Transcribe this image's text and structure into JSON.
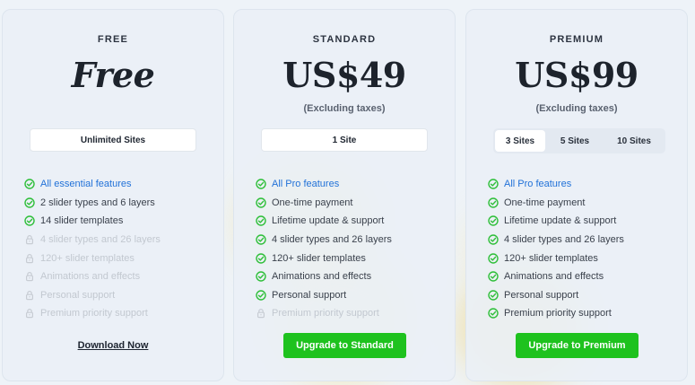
{
  "plans": {
    "free": {
      "tier": "FREE",
      "price": "Free",
      "sites_label": "Unlimited Sites",
      "features": [
        {
          "text": "All essential features",
          "state": "link"
        },
        {
          "text": "2 slider types and 6 layers",
          "state": "included"
        },
        {
          "text": "14 slider templates",
          "state": "included"
        },
        {
          "text": "4 slider types and 26 layers",
          "state": "locked"
        },
        {
          "text": "120+ slider templates",
          "state": "locked"
        },
        {
          "text": "Animations and effects",
          "state": "locked"
        },
        {
          "text": "Personal support",
          "state": "locked"
        },
        {
          "text": "Premium priority support",
          "state": "locked"
        }
      ],
      "action_label": "Download Now"
    },
    "standard": {
      "tier": "STANDARD",
      "price": "US$49",
      "taxes": "(Excluding taxes)",
      "sites_label": "1 Site",
      "features": [
        {
          "text": "All Pro features",
          "state": "link"
        },
        {
          "text": "One-time payment",
          "state": "included"
        },
        {
          "text": "Lifetime update & support",
          "state": "included"
        },
        {
          "text": "4 slider types and 26 layers",
          "state": "included"
        },
        {
          "text": "120+ slider templates",
          "state": "included"
        },
        {
          "text": "Animations and effects",
          "state": "included"
        },
        {
          "text": "Personal support",
          "state": "included"
        },
        {
          "text": "Premium priority support",
          "state": "locked"
        }
      ],
      "action_label": "Upgrade to Standard"
    },
    "premium": {
      "tier": "PREMIUM",
      "price": "US$99",
      "taxes": "(Excluding taxes)",
      "site_options": [
        "3 Sites",
        "5 Sites",
        "10 Sites"
      ],
      "selected_site_option": "3 Sites",
      "features": [
        {
          "text": "All Pro features",
          "state": "link"
        },
        {
          "text": "One-time payment",
          "state": "included"
        },
        {
          "text": "Lifetime update & support",
          "state": "included"
        },
        {
          "text": "4 slider types and 26 layers",
          "state": "included"
        },
        {
          "text": "120+ slider templates",
          "state": "included"
        },
        {
          "text": "Animations and effects",
          "state": "included"
        },
        {
          "text": "Personal support",
          "state": "included"
        },
        {
          "text": "Premium priority support",
          "state": "included"
        }
      ],
      "action_label": "Upgrade to Premium"
    }
  },
  "colors": {
    "check": "#2fbf3a",
    "lock": "#c7ccd3",
    "link": "#2272d8",
    "cta": "#1ec21e"
  },
  "icons": {
    "included": "check-circle-icon",
    "link": "check-circle-icon",
    "locked": "lock-icon"
  }
}
